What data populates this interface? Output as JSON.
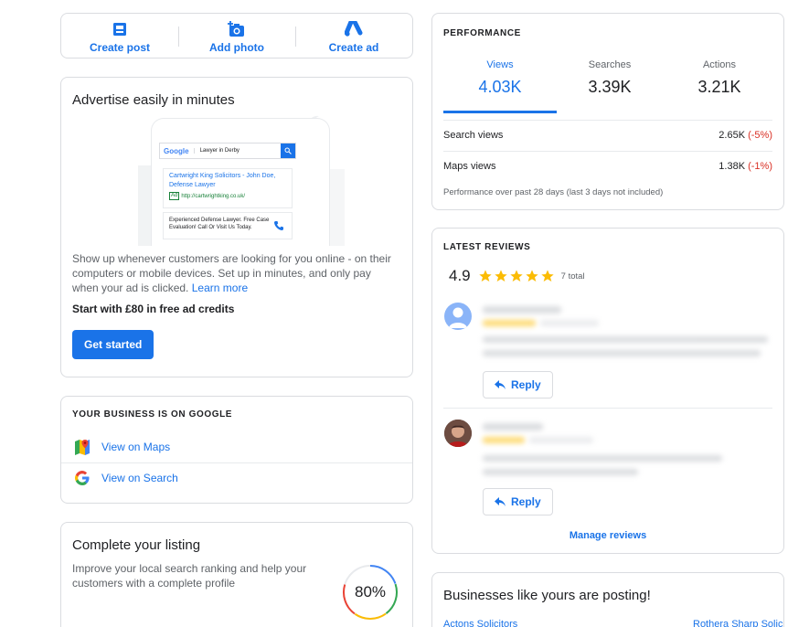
{
  "quick_actions": {
    "create_post": "Create post",
    "add_photo": "Add photo",
    "create_ad": "Create ad"
  },
  "advertise": {
    "title": "Advertise easily in minutes",
    "mockup": {
      "google_logo": "Google",
      "search_query": "Lawyer in Derby",
      "ad_title": "Cartwright King Solicitors - John Doe, Defense Lawyer",
      "ad_badge": "Ad",
      "ad_url": "http://cartwrightking.co.uk/",
      "ad_desc": "Experienced Defense Lawyer. Free Case Evaluation! Call Or Visit Us Today."
    },
    "description": "Show up whenever customers are looking for you online - on their computers or mobile devices. Set up in minutes, and only pay when your ad is clicked.",
    "learn_more": "Learn more",
    "credit_text": "Start with £80 in free ad credits",
    "cta": "Get started"
  },
  "business_on_google": {
    "heading": "YOUR BUSINESS IS ON GOOGLE",
    "maps_link": "View on Maps",
    "search_link": "View on Search"
  },
  "complete_listing": {
    "title": "Complete your listing",
    "description": "Improve your local search ranking and help your customers with a complete profile",
    "progress_label": "80%",
    "progress": 0.8
  },
  "performance": {
    "heading": "PERFORMANCE",
    "tabs": [
      {
        "label": "Views",
        "value": "4.03K"
      },
      {
        "label": "Searches",
        "value": "3.39K"
      },
      {
        "label": "Actions",
        "value": "3.21K"
      }
    ],
    "rows": [
      {
        "label": "Search views",
        "value": "2.65K",
        "change": "(-5%)"
      },
      {
        "label": "Maps views",
        "value": "1.38K",
        "change": "(-1%)"
      }
    ],
    "footnote": "Performance over past 28 days (last 3 days not included)"
  },
  "reviews": {
    "heading": "LATEST REVIEWS",
    "rating": "4.9",
    "total": "7 total",
    "items": [
      {
        "reply_label": "Reply"
      },
      {
        "reply_label": "Reply"
      }
    ],
    "manage_link": "Manage reviews"
  },
  "businesses_posting": {
    "title": "Businesses like yours are posting!",
    "left_link": "Actons Solicitors",
    "right_link": "Rothera Sharp Solic"
  },
  "colors": {
    "accent": "#1a73e8",
    "star": "#fbbc04",
    "negative": "#d93025"
  }
}
